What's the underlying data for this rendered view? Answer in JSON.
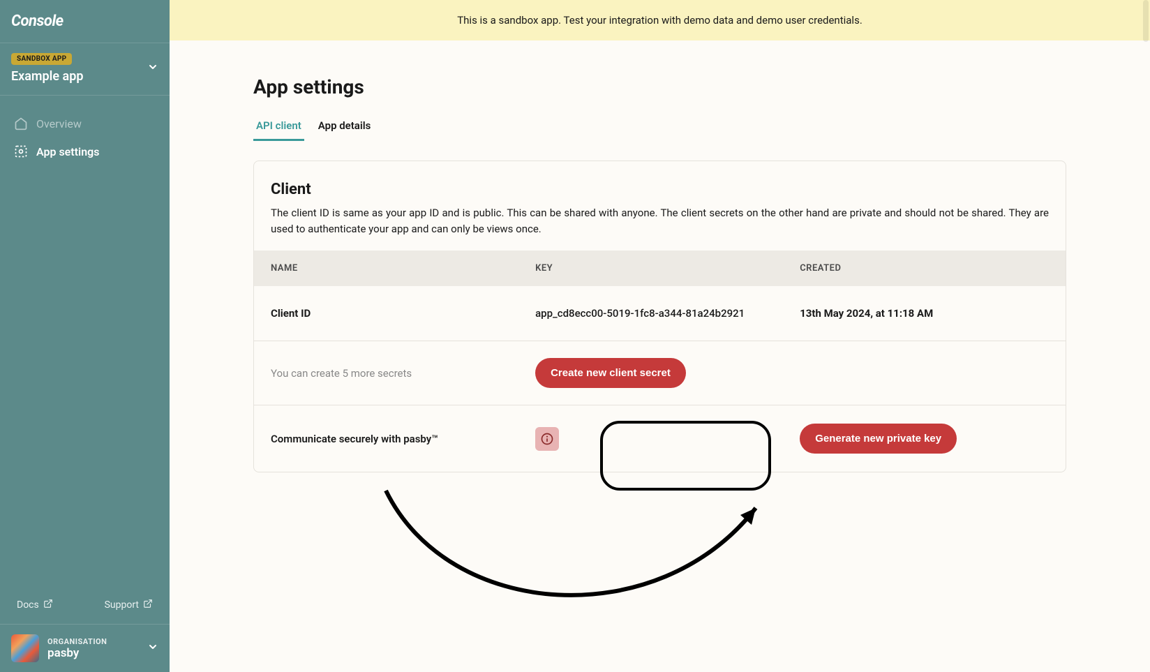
{
  "sidebar": {
    "logo": "Console",
    "sandbox_badge": "SANDBOX APP",
    "app_name": "Example app",
    "nav": {
      "overview": "Overview",
      "settings": "App settings"
    },
    "footer": {
      "docs": "Docs",
      "support": "Support"
    },
    "org": {
      "label": "ORGANISATION",
      "name": "pasby"
    }
  },
  "banner": {
    "text": "This is a sandbox app. Test your integration with demo data and demo user credentials."
  },
  "page": {
    "title": "App settings",
    "tabs": {
      "api_client": "API client",
      "app_details": "App details"
    }
  },
  "client_card": {
    "title": "Client",
    "description": "The client ID is same as your app ID and is public. This can be shared with anyone. The client secrets on the other hand are private and should not be shared. They are used to authenticate your app and can only be views once.",
    "columns": {
      "name": "NAME",
      "key": "KEY",
      "created": "CREATED"
    },
    "row": {
      "name": "Client ID",
      "key": "app_cd8ecc00-5019-1fc8-a344-81a24b2921",
      "created": "13th May 2024, at 11:18 AM"
    },
    "secret_hint": "You can create 5 more secrets",
    "create_secret_btn": "Create new client secret",
    "pk_label": "Communicate securely with pasby™",
    "generate_pk_btn": "Generate new private key"
  }
}
